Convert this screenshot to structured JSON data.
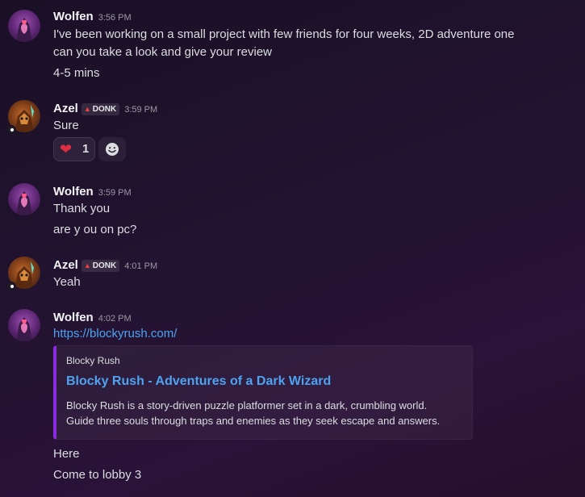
{
  "colors": {
    "link": "#4ea3f1",
    "embed_accent": "#8a2be2",
    "heart": "#dd2e44",
    "tag_icon": "#ed4245"
  },
  "messages": [
    {
      "author": "Wolfen",
      "time": "3:56 PM",
      "avatar": "wolfen-avatar",
      "lines": [
        "I've been working on a small project with few friends for four weeks, 2D adventure one",
        "can you take a look and give your review",
        "4-5 mins"
      ]
    },
    {
      "author": "Azel",
      "tag": "DONK",
      "time": "3:59 PM",
      "avatar": "azel-avatar",
      "lines": [
        "Sure"
      ],
      "reaction": {
        "emoji": "heart-icon",
        "count": "1"
      }
    },
    {
      "author": "Wolfen",
      "time": "3:59 PM",
      "avatar": "wolfen-avatar",
      "lines": [
        "Thank you",
        "are y ou on pc?"
      ]
    },
    {
      "author": "Azel",
      "tag": "DONK",
      "time": "4:01 PM",
      "avatar": "azel-avatar",
      "lines": [
        "Yeah"
      ]
    },
    {
      "author": "Wolfen",
      "time": "4:02 PM",
      "avatar": "wolfen-avatar",
      "link": "https://blockyrush.com/",
      "embed": {
        "provider": "Blocky Rush",
        "title": "Blocky Rush - Adventures of a Dark Wizard",
        "description": [
          "Blocky Rush is a story-driven puzzle platformer set in a dark, crumbling world.",
          "Guide three souls through traps and enemies as they seek escape and answers."
        ]
      },
      "after_lines": [
        "Here",
        "Come to lobby 3"
      ]
    }
  ]
}
